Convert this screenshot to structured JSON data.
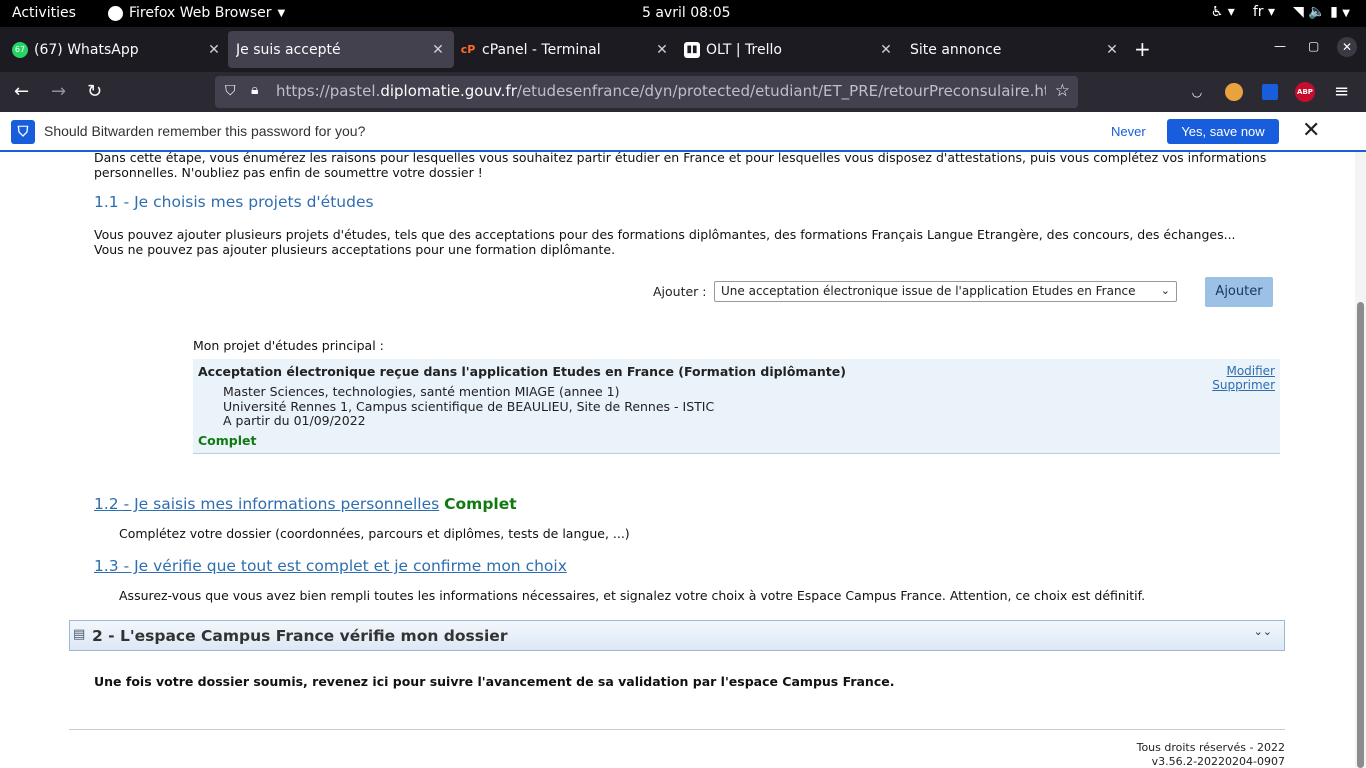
{
  "system": {
    "activities": "Activities",
    "app_name": "Firefox Web Browser",
    "clock": "5 avril  08:05",
    "lang": "fr"
  },
  "tabs": [
    {
      "title": "(67) WhatsApp",
      "badge": "67",
      "active": false
    },
    {
      "title": "Je suis accepté",
      "active": true
    },
    {
      "title": "cPanel - Terminal",
      "active": false
    },
    {
      "title": "OLT | Trello",
      "active": false
    },
    {
      "title": "Site annonce",
      "active": false
    }
  ],
  "url": {
    "prefix": "https://pastel.",
    "domain": "diplomatie.gouv.fr",
    "path": "/etudesenfrance/dyn/protected/etudiant/ET_PRE/retourPreconsulaire.html?s"
  },
  "extensions": {
    "abp": "ABP"
  },
  "bitwarden": {
    "message": "Should Bitwarden remember this password for you?",
    "never": "Never",
    "save": "Yes, save now"
  },
  "page": {
    "intro_line1": "Dans cette étape, vous énumérez les raisons pour lesquelles vous souhaitez partir étudier en France et pour lesquelles vous disposez d'attestations, puis vous complétez vos informations",
    "intro_line2": "personnelles. N'oubliez pas enfin de soumettre votre dossier !",
    "s11_title": "1.1 - Je choisis mes projets d'études",
    "s11_text1": "Vous pouvez ajouter plusieurs projets d'études, tels que des acceptations pour des formations diplômantes, des formations Français Langue Etrangère, des concours, des échanges...",
    "s11_text2": "Vous ne pouvez pas ajouter plusieurs acceptations pour une formation diplômante.",
    "add_label": "Ajouter :",
    "add_select_value": "Une acceptation électronique issue de l'application Etudes en France",
    "add_button": "Ajouter",
    "main_project_label": "Mon projet d'études principal :",
    "project": {
      "title": "Acceptation électronique reçue dans l'application Etudes en France (Formation diplômante)",
      "line1": "Master Sciences, technologies, santé mention MIAGE (annee 1)",
      "line2": "Université Rennes 1, Campus scientifique de BEAULIEU, Site de Rennes - ISTIC",
      "line3": "A partir du 01/09/2022",
      "status": "Complet",
      "modify": "Modifier",
      "delete": "Supprimer"
    },
    "s12_title": "1.2 - Je saisis mes informations personnelles",
    "s12_status": "Complet",
    "s12_text": "Complétez votre dossier (coordonnées, parcours et diplômes, tests de langue, ...)",
    "s13_title": "1.3 - Je vérifie que tout est complet et je confirme mon choix",
    "s13_text": "Assurez-vous que vous avez bien rempli toutes les informations nécessaires, et signalez votre choix à votre Espace Campus France. Attention, ce choix est définitif.",
    "s2_title": "2 - L'espace Campus France vérifie mon dossier",
    "s2_text": "Une fois votre dossier soumis, revenez ici pour suivre l'avancement de sa validation par l'espace Campus France.",
    "footer_rights": "Tous droits réservés - 2022",
    "footer_version": "v3.56.2-20220204-0907"
  },
  "colors": {
    "link_blue": "#2e6eb0",
    "status_green": "#107a10",
    "bitwarden_blue": "#175ddc"
  }
}
